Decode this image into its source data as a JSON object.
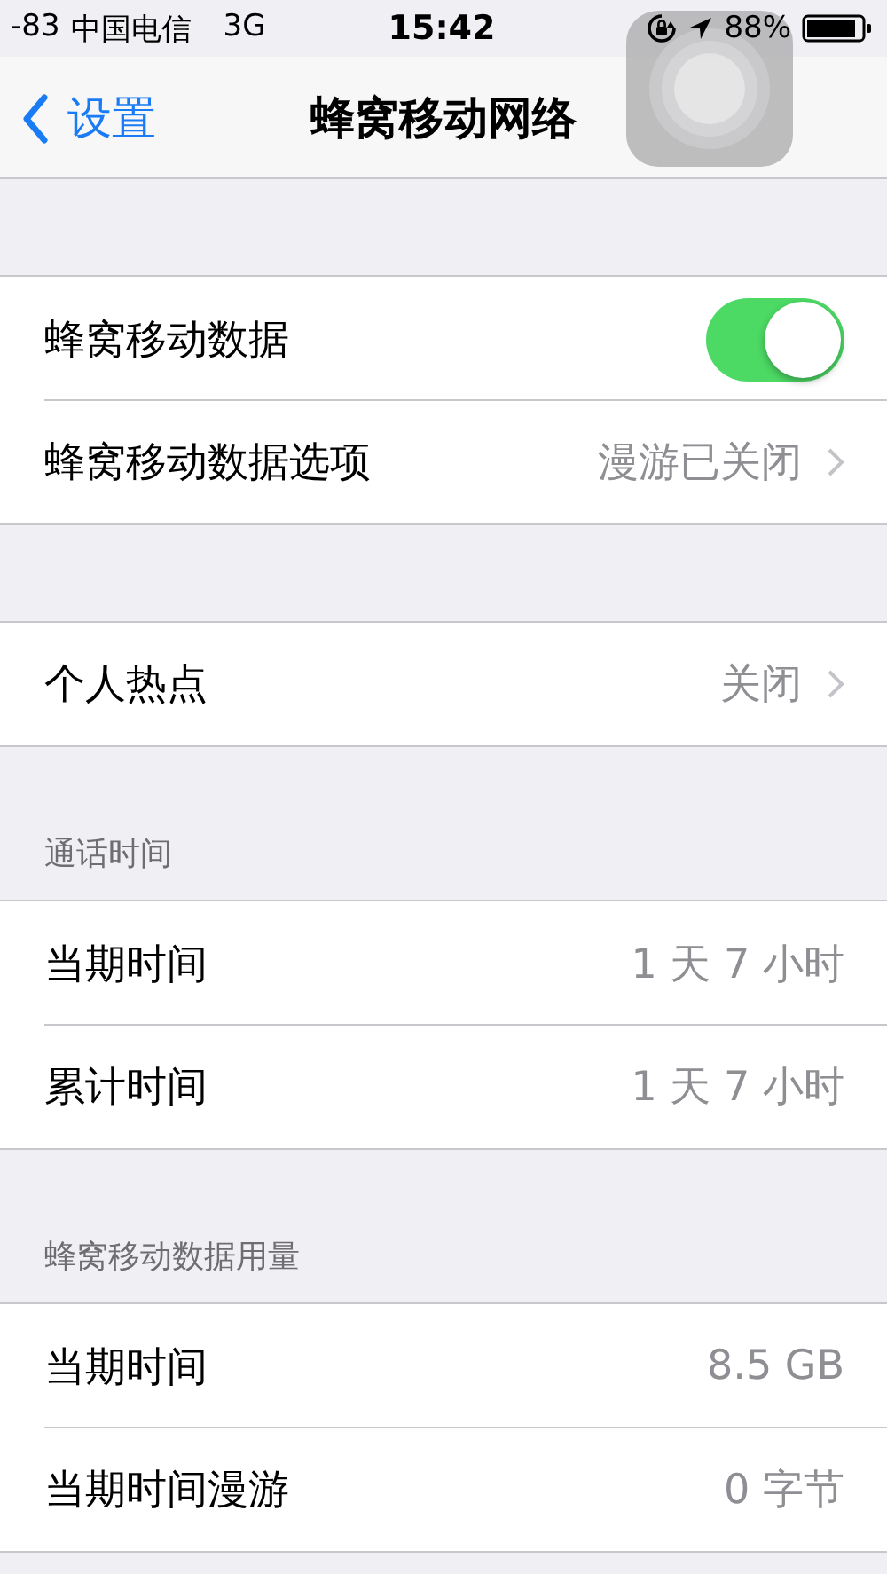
{
  "status_bar": {
    "signal": "-83",
    "carrier": "中国电信",
    "network": "3G",
    "time": "15:42",
    "battery": "88%"
  },
  "nav": {
    "back": "设置",
    "title": "蜂窝移动网络"
  },
  "sections": [
    {
      "rows": [
        {
          "kind": "toggle",
          "label": "蜂窝移动数据",
          "on": true
        },
        {
          "kind": "link",
          "label": "蜂窝移动数据选项",
          "value": "漫游已关闭"
        }
      ]
    },
    {
      "rows": [
        {
          "kind": "link",
          "label": "个人热点",
          "value": "关闭"
        }
      ]
    },
    {
      "header": "通话时间",
      "rows": [
        {
          "kind": "value",
          "label": "当期时间",
          "value": "1 天 7 小时"
        },
        {
          "kind": "value",
          "label": "累计时间",
          "value": "1 天 7 小时"
        }
      ]
    },
    {
      "header": "蜂窝移动数据用量",
      "rows": [
        {
          "kind": "value",
          "label": "当期时间",
          "value": "8.5 GB"
        },
        {
          "kind": "value",
          "label": "当期时间漫游",
          "value": "0 字节"
        }
      ]
    }
  ]
}
